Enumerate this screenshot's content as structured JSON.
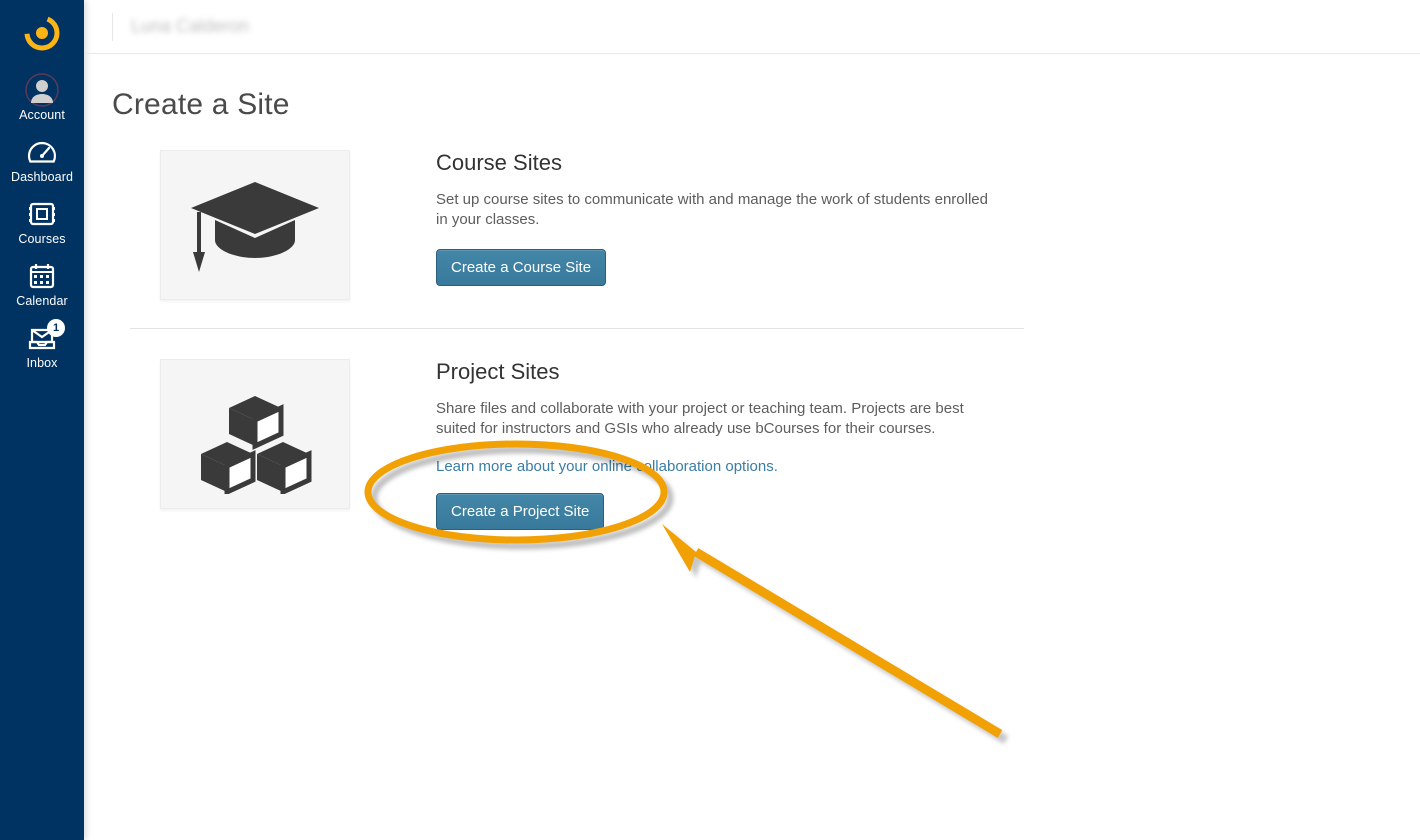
{
  "sidebar": {
    "items": [
      {
        "label": "Account"
      },
      {
        "label": "Dashboard"
      },
      {
        "label": "Courses"
      },
      {
        "label": "Calendar"
      },
      {
        "label": "Inbox",
        "badge": "1"
      }
    ]
  },
  "breadcrumb": "Luna Calderon",
  "page": {
    "title": "Create a Site"
  },
  "course": {
    "title": "Course Sites",
    "desc": "Set up course sites to communicate with and manage the work of students enrolled in your classes.",
    "button": "Create a Course Site"
  },
  "project": {
    "title": "Project Sites",
    "desc": "Share files and collaborate with your project or teaching team. Projects are best suited for instructors and GSIs who already use bCourses for their courses.",
    "link": "Learn more about your online collaboration options.",
    "button": "Create a Project Site"
  }
}
